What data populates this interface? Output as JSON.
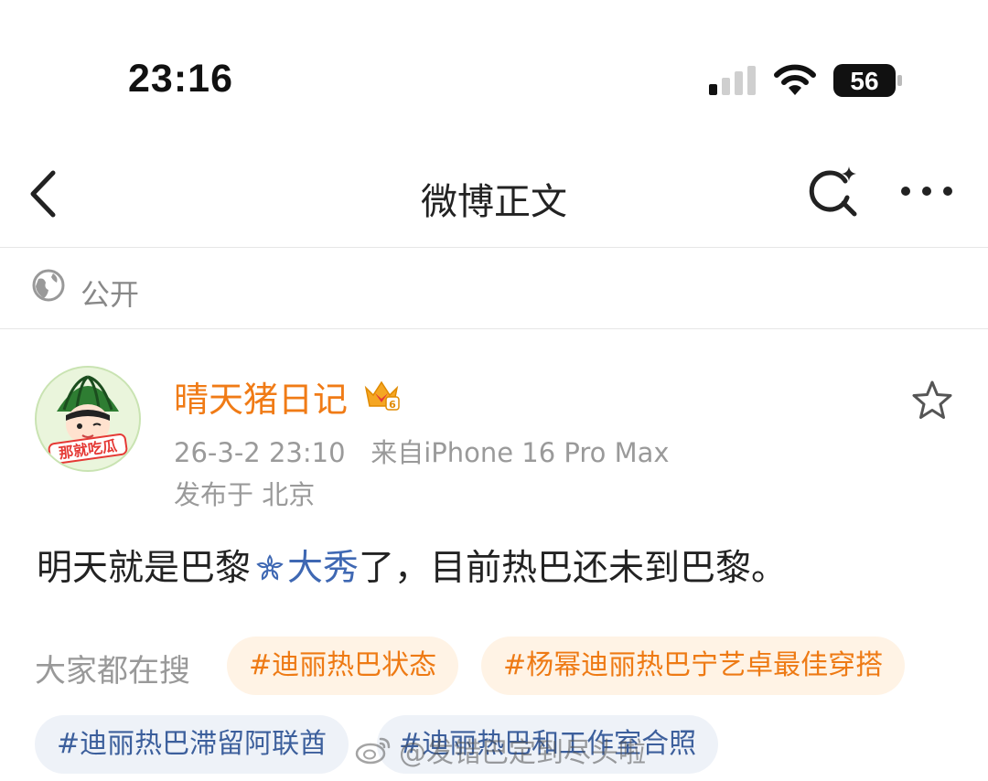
{
  "status_bar": {
    "time": "23:16",
    "battery": "56",
    "icons": [
      "cellular-signal-icon",
      "wifi-icon",
      "battery-icon"
    ]
  },
  "nav": {
    "title": "微博正文",
    "icons": [
      "back-chevron-icon",
      "search-sparkle-icon",
      "more-dots-icon"
    ]
  },
  "privacy": {
    "label": "公开",
    "icon": "globe-icon"
  },
  "author": {
    "name": "晴天猪日记",
    "badge_icon": "crown-badge-icon",
    "avatar_text": "那就吃瓜"
  },
  "meta": {
    "timestamp": "26-3-2 23:10",
    "source": "来自iPhone 16 Pro Max",
    "location": "发布于 北京"
  },
  "post": {
    "before": "明天就是巴黎",
    "topic": "大秀",
    "after": "了，目前热巴还未到巴黎。"
  },
  "trending": {
    "label": "大家都在搜",
    "chips": [
      "#迪丽热巴状态",
      "#杨幂迪丽热巴宁艺卓最佳穿搭",
      "#迪丽热巴滞留阿联酋",
      "#迪丽热巴和工作室合照"
    ]
  },
  "watermark": {
    "text": "@发错巴定到尽头啦"
  },
  "colors": {
    "username": "#f07b16",
    "topic": "#3f68b3",
    "chip_orange_bg": "#fff3e5",
    "chip_orange_text": "#ee7a14",
    "chip_blue_bg": "#eef2f8",
    "chip_blue_text": "#3c5f9c",
    "meta": "#9a9a9a"
  }
}
